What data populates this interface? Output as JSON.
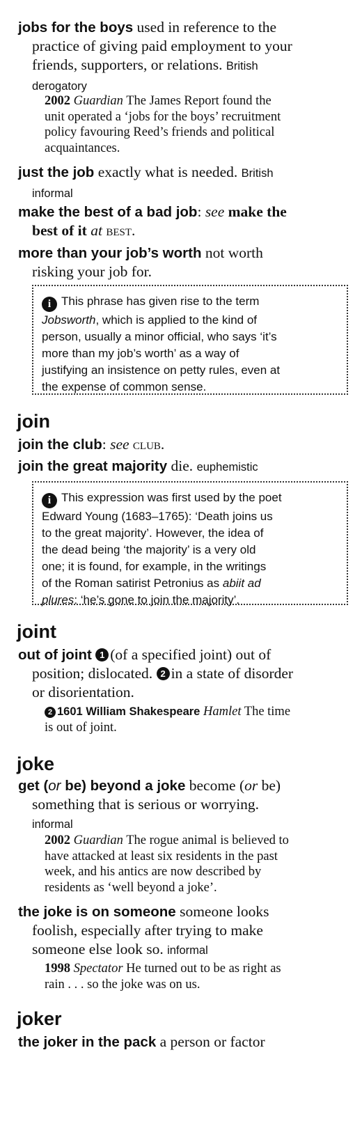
{
  "jobs_for_the_boys": {
    "headword": "jobs for the boys",
    "def_l1": "used in reference to the",
    "def_l2": "practice of giving paid employment to your",
    "def_l3": "friends, supporters, or relations.",
    "label_1": "British",
    "label_2": "derogatory",
    "quote": {
      "year": "2002",
      "source": "Guardian",
      "l1": "The James Report found the",
      "l2": "unit operated a ‘jobs for the boys’ recruitment",
      "l3": "policy favouring Reed’s friends and political",
      "l4": "acquaintances."
    }
  },
  "just_the_job": {
    "headword": "just the job",
    "def": "exactly what is needed.",
    "label_1": "British",
    "label_2": "informal"
  },
  "make_the_best": {
    "headword": "make the best of a bad job",
    "colon": ":",
    "see": "see",
    "xref_1": "make the",
    "xref_2": "best of it",
    "at": "at",
    "target": "best",
    "period": "."
  },
  "more_than_jobs_worth": {
    "headword": "more than your job’s worth",
    "def_l1": "not worth",
    "def_l2": "risking your job for."
  },
  "note_jobsworth": {
    "icon": "i",
    "l1": "This phrase has given rise to the term",
    "l2_em": "Jobsworth",
    "l2": ", which is applied to the kind of",
    "l3": "person, usually a minor official, who says ‘it’s",
    "l4": "more than my job’s worth’ as a way of",
    "l5": "justifying an insistence on petty rules, even at",
    "l6": "the expense of common sense."
  },
  "section_join": {
    "title": "join"
  },
  "join_the_club": {
    "headword": "join the club",
    "colon": ":",
    "see": "see",
    "target": "club",
    "period": "."
  },
  "join_great_majority": {
    "headword": "join the great majority",
    "def": "die.",
    "label": "euphemistic"
  },
  "note_majority": {
    "icon": "i",
    "l1": "This expression was first used by the poet",
    "l2": "Edward Young (1683–1765): ‘Death joins us",
    "l3": "to the great majority’. However, the idea of",
    "l4": "the dead being ‘the majority’ is a very old",
    "l5": "one; it is found, for example, in the writings",
    "l6": "of the Roman satirist Petronius as",
    "l6_em": "abiit ad",
    "l7_em": "plures",
    "l7": ": ‘he’s gone to join the majority’."
  },
  "section_joint": {
    "title": "joint"
  },
  "out_of_joint": {
    "headword": "out of joint",
    "sense1_num": "1",
    "sense1_l1": "(of a specified joint) out of",
    "sense1_l2": "position; dislocated.",
    "sense2_num": "2",
    "sense2_l2": "in a state of disorder",
    "sense2_l3": "or disorientation.",
    "quote": {
      "sense_num": "2",
      "year": "1601",
      "author": "William Shakespeare",
      "source": "Hamlet",
      "l1": "The time",
      "l2": "is out of joint."
    }
  },
  "section_joke": {
    "title": "joke"
  },
  "beyond_a_joke": {
    "hw_1": "get (",
    "hw_or_1": "or",
    "hw_2": " be) beyond a joke",
    "def_l1a": "become (",
    "def_or": "or",
    "def_l1b": " be)",
    "def_l2": "something that is serious or worrying.",
    "label": "informal",
    "quote": {
      "year": "2002",
      "source": "Guardian",
      "l1": "The rogue animal is believed to",
      "l2": "have attacked at least six residents in the past",
      "l3": "week, and his antics are now described by",
      "l4": "residents as ‘well beyond a joke’."
    }
  },
  "joke_on_someone": {
    "headword": "the joke is on someone",
    "def_l1": "someone looks",
    "def_l2": "foolish, especially after trying to make",
    "def_l3": "someone else look so.",
    "label": "informal",
    "quote": {
      "year": "1998",
      "source": "Spectator",
      "l1": "He turned out to be as right as",
      "l2": "rain . . . so the joke was on us."
    }
  },
  "section_joker": {
    "title": "joker"
  },
  "joker_in_pack": {
    "headword": "the joker in the pack",
    "def": "a person or factor"
  }
}
